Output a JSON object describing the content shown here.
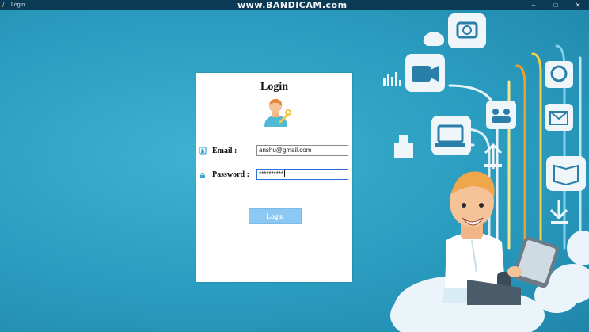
{
  "window": {
    "title": "Login",
    "watermark": "www.BANDICAM.com",
    "controls": [
      "–",
      "□",
      "✕"
    ]
  },
  "login": {
    "heading": "Login",
    "email_label": "Email :",
    "email_value": "anshu@gmail.com",
    "password_label": "Password :",
    "password_value": "**********",
    "button_label": "Login"
  },
  "colors": {
    "background": "#2a9cbf",
    "titlebar": "#0b3a55",
    "button": "#8cc8f2",
    "card": "#ffffff"
  },
  "icons": [
    "app-icon",
    "user-avatar-icon",
    "id-card-icon",
    "lock-icon"
  ]
}
